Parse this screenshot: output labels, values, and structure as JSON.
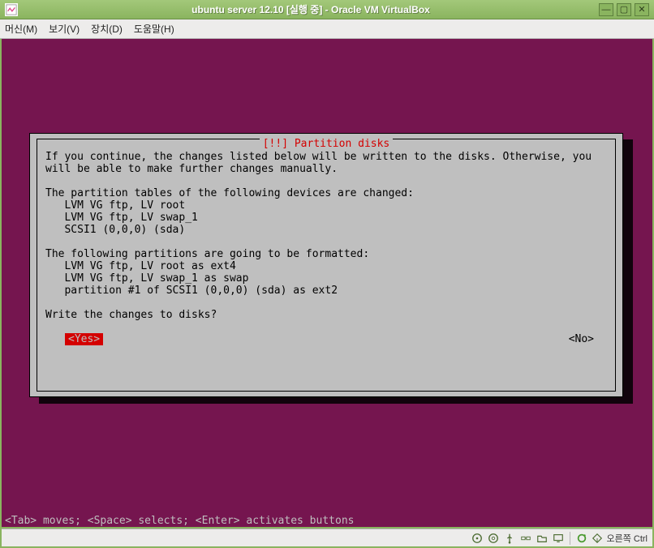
{
  "window": {
    "title": "ubuntu server 12.10 [실행 중] - Oracle VM VirtualBox"
  },
  "menu": {
    "machine": "머신(M)",
    "view": "보기(V)",
    "devices": "장치(D)",
    "help": "도움말(H)"
  },
  "dialog": {
    "title": "[!!] Partition disks",
    "para1": "If you continue, the changes listed below will be written to the disks. Otherwise, you will be able to make further changes manually.",
    "tables_heading": "The partition tables of the following devices are changed:",
    "tables": [
      "LVM VG ftp, LV root",
      "LVM VG ftp, LV swap_1",
      "SCSI1 (0,0,0) (sda)"
    ],
    "format_heading": "The following partitions are going to be formatted:",
    "formats": [
      "LVM VG ftp, LV root as ext4",
      "LVM VG ftp, LV swap_1 as swap",
      "partition #1 of SCSI1 (0,0,0) (sda) as ext2"
    ],
    "question": "Write the changes to disks?",
    "yes": "<Yes>",
    "no": "<No>"
  },
  "hint": "<Tab> moves; <Space> selects; <Enter> activates buttons",
  "status": {
    "host_key": "오른쪽 Ctrl"
  }
}
